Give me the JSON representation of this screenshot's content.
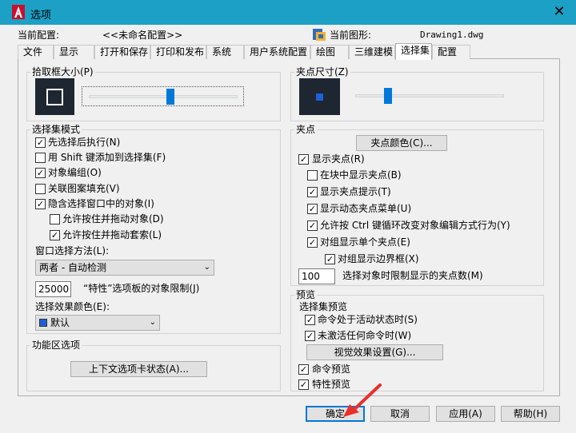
{
  "window": {
    "title": "选项",
    "close_glyph": "✕"
  },
  "header": {
    "profile_label": "当前配置:",
    "profile_value": "<<未命名配置>>",
    "drawing_label": "当前图形:",
    "drawing_value": "Drawing1.dwg"
  },
  "tabs": [
    {
      "label": "文件"
    },
    {
      "label": "显示"
    },
    {
      "label": "打开和保存"
    },
    {
      "label": "打印和发布"
    },
    {
      "label": "系统"
    },
    {
      "label": "用户系统配置"
    },
    {
      "label": "绘图"
    },
    {
      "label": "三维建模"
    },
    {
      "label": "选择集"
    },
    {
      "label": "配置"
    }
  ],
  "active_tab": "选择集",
  "pickbox": {
    "label": "拾取框大小(P)",
    "slider_fraction": 0.55
  },
  "grip_size": {
    "label": "夹点尺寸(Z)",
    "slider_fraction": 0.22
  },
  "selection_modes": {
    "label": "选择集模式",
    "items": [
      {
        "label": "先选择后执行(N)",
        "checked": true
      },
      {
        "label": "用 Shift 键添加到选择集(F)",
        "checked": false
      },
      {
        "label": "对象编组(O)",
        "checked": true
      },
      {
        "label": "关联图案填充(V)",
        "checked": false
      },
      {
        "label": "隐含选择窗口中的对象(I)",
        "checked": true
      },
      {
        "label": "允许按住并拖动对象(D)",
        "checked": false
      },
      {
        "label": "允许按住并拖动套索(L)",
        "checked": true
      }
    ],
    "window_method_label": "窗口选择方法(L):",
    "window_method_value": "两者 - 自动检测",
    "object_limit_value": "25000",
    "object_limit_label": "“特性”选项板的对象限制(J)",
    "effect_color_label": "选择效果颜色(E):",
    "effect_color_value": "默认",
    "effect_color_swatch": "#1f5fd9"
  },
  "ribbon": {
    "label": "功能区选项",
    "button": "上下文选项卡状态(A)..."
  },
  "grips": {
    "label": "夹点",
    "color_button": "夹点颜色(C)...",
    "items": [
      {
        "label": "显示夹点(R)",
        "checked": true
      },
      {
        "label": "在块中显示夹点(B)",
        "checked": false
      },
      {
        "label": "显示夹点提示(T)",
        "checked": true
      },
      {
        "label": "显示动态夹点菜单(U)",
        "checked": true
      },
      {
        "label": "允许按 Ctrl 键循环改变对象编辑方式行为(Y)",
        "checked": true
      },
      {
        "label": "对组显示单个夹点(E)",
        "checked": true
      },
      {
        "label": "对组显示边界框(X)",
        "checked": true
      }
    ],
    "limit_value": "100",
    "limit_label": "选择对象时限制显示的夹点数(M)"
  },
  "preview": {
    "label": "预览",
    "sub_label": "选择集预览",
    "items": [
      {
        "label": "命令处于活动状态时(S)",
        "checked": true
      },
      {
        "label": "未激活任何命令时(W)",
        "checked": true
      }
    ],
    "visual_button": "视觉效果设置(G)...",
    "cmd_preview": {
      "label": "命令预览",
      "checked": true
    },
    "prop_preview": {
      "label": "特性预览",
      "checked": true
    }
  },
  "footer": {
    "ok": "确定",
    "cancel": "取消",
    "apply": "应用(A)",
    "help": "帮助(H)"
  },
  "colors": {
    "titlebar": "#1ca0c6",
    "accent": "#0078d7",
    "preview_bg": "#1e2632",
    "arrow": "#e8302a"
  }
}
